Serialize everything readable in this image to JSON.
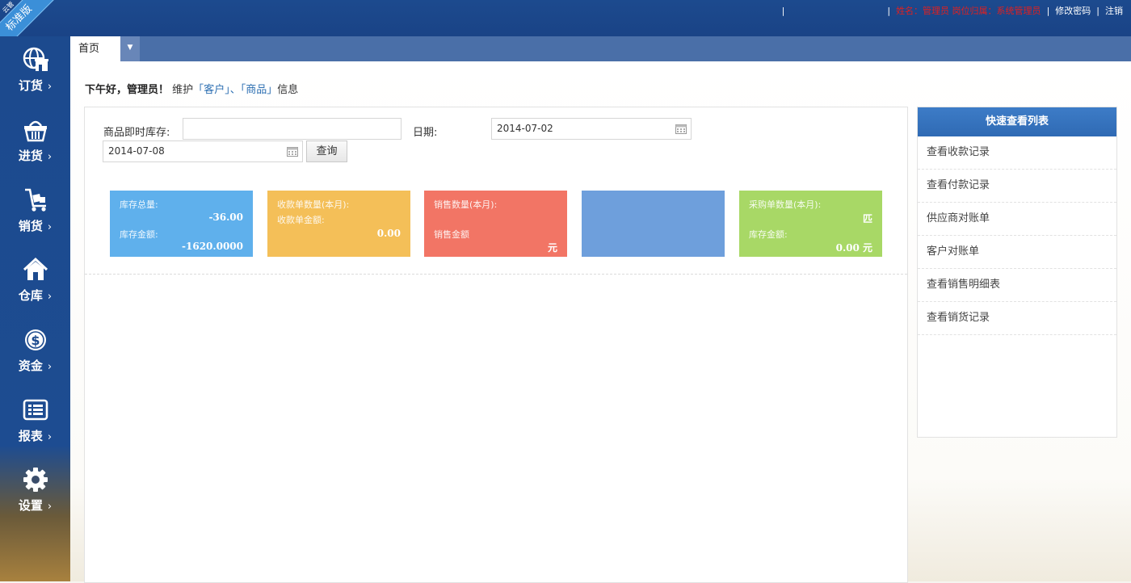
{
  "brand": {
    "ribbon_main": "标准版",
    "ribbon_small": "云管"
  },
  "topnav": {
    "user_info": "姓名：管理员  岗位归属：系统管理员",
    "change_password": "修改密码",
    "logout": "注销"
  },
  "sidebar": {
    "items": [
      {
        "label": "订货",
        "icon": "globe-shop-icon"
      },
      {
        "label": "进货",
        "icon": "basket-icon"
      },
      {
        "label": "销货",
        "icon": "cart-icon"
      },
      {
        "label": "仓库",
        "icon": "home-icon"
      },
      {
        "label": "资金",
        "icon": "dollar-icon"
      },
      {
        "label": "报表",
        "icon": "report-icon"
      },
      {
        "label": "设置",
        "icon": "gear-icon"
      }
    ]
  },
  "tabs": {
    "home": "首页"
  },
  "greeting": {
    "hello": "下午好，管理员！",
    "maintain": "维护",
    "q1": "「",
    "customer": "客户",
    "q2": "」、「",
    "product": "商品",
    "q3": "」",
    "info": "信息"
  },
  "form": {
    "stock_label": "商品即时库存:",
    "stock_value": "",
    "date_label": "日期:",
    "date_from": "2014-07-02",
    "date_to": "2014-07-08",
    "query_button": "查询"
  },
  "cards": [
    {
      "color": "#5fb0ec",
      "t1": "库存总量:",
      "v1": "-36.00",
      "t2": "库存金额:",
      "v2": "-1620.0000"
    },
    {
      "color": "#f4bf58",
      "t1": "收款单数量(本月):",
      "t2": "收款单金额:",
      "v2": "0.00"
    },
    {
      "color": "#f27565",
      "t1": "销售数量(本月):",
      "t2": "销售金额",
      "v3": "元"
    },
    {
      "color": "#6e9fdc"
    },
    {
      "color": "#a8d866",
      "t1": "采购单数量(本月):",
      "v1": "匹",
      "t2": "库存金额:",
      "v2": "0.00 元"
    }
  ],
  "quick_list": {
    "title": "快速查看列表",
    "items": [
      "查看收款记录",
      "查看付款记录",
      "供应商对账单",
      "客户对账单",
      "查看销售明细表",
      "查看销货记录"
    ]
  }
}
